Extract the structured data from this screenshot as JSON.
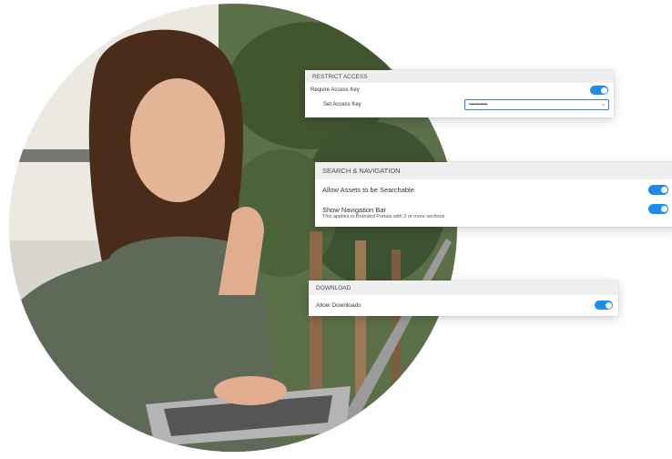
{
  "restrict_access": {
    "header": "RESTRICT ACCESS",
    "require_access_key_label": "Require Access Key",
    "set_access_key_label": "Set Access Key",
    "access_key_value": "••••••••••••••••"
  },
  "search_navigation": {
    "header": "SEARCH & NAVIGATION",
    "allow_searchable_label": "Allow Assets to be Searchable",
    "show_navigation_label": "Show Navigation Bar",
    "show_navigation_note": "This applies to Branded Portals with 2 or more sections"
  },
  "download": {
    "header": "DOWNLOAD",
    "allow_downloads_label": "Allow Downloads"
  },
  "colors": {
    "toggle_on": "#1f8ceb",
    "panel_header_bg": "#efefef"
  },
  "icons": {
    "select_chevron": "chevron-down-icon"
  }
}
